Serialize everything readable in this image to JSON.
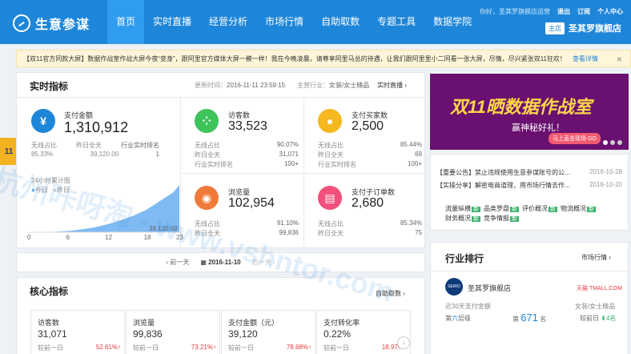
{
  "app": {
    "name": "生意参谋"
  },
  "nav": [
    "首页",
    "实时直播",
    "经营分析",
    "市场行情",
    "自助取数",
    "专题工具",
    "数据学院"
  ],
  "top_right": {
    "welcome": "你好，圣其罗旗舰店运营",
    "logout": "退出",
    "subscribe": "订阅",
    "personal": "个人中心"
  },
  "store": {
    "tag": "主店",
    "name": "圣其罗旗舰店"
  },
  "notice": {
    "text": "【双11官方同款大屏】数据作战室作战大屏今夜“变身”，跟阿里官方媒体大屏一模一样！我在今晚凌晨，请尊享阿里马总的待遇，让我们跟阿里里小二同看一张大屏，尽情，尽兴紧张双11狂欢！",
    "link": "查看详情",
    "close": "×"
  },
  "realtime": {
    "title": "实时指标",
    "updated_label": "更新时间：",
    "updated": "2016-11-11 23:59:15",
    "industry_label": "主营行业：",
    "industry": "女装/女士精品",
    "live_link": "实时直播",
    "metrics": [
      {
        "label": "支付金额",
        "value": "1,310,912",
        "icon": "yen-icon",
        "rows": [
          [
            "无线占比",
            ""
          ],
          [
            "85.33%",
            ""
          ]
        ],
        "sub1_label": "无线占比",
        "sub1": "85.33%",
        "sub2_label": "昨日全天",
        "sub2": "39,120.00",
        "sub3_label": "行业实时排名",
        "sub3": "1"
      },
      {
        "label": "访客数",
        "value": "33,523",
        "icon": "footprint-icon",
        "sub1_label": "无线占比",
        "sub1": "90.07%",
        "sub2_label": "昨日全天",
        "sub2": "31,071",
        "sub3_label": "行业实时排名",
        "sub3": "100+"
      },
      {
        "label": "支付买家数",
        "value": "2,500",
        "icon": "user-icon",
        "sub1_label": "无线占比",
        "sub1": "85.44%",
        "sub2_label": "昨日全天",
        "sub2": "69",
        "sub3_label": "行业实时排名",
        "sub3": "100+"
      },
      {
        "label": "浏览量",
        "value": "102,954",
        "icon": "eye-icon",
        "sub1_label": "无线占比",
        "sub1": "91.10%",
        "sub2_label": "昨日全天",
        "sub2": "99,836"
      },
      {
        "label": "支付子订单数",
        "value": "2,680",
        "icon": "order-icon",
        "sub1_label": "无线占比",
        "sub1": "85.34%",
        "sub2_label": "昨日全天",
        "sub2": "75"
      }
    ],
    "chart": {
      "title": "24小时累计图",
      "legend_today": "今日",
      "legend_yesterday": "昨日",
      "ticks": [
        "0",
        "6",
        "12",
        "18",
        "23"
      ],
      "end_value": "39,120.00"
    }
  },
  "chart_data": {
    "type": "area",
    "title": "24小时累计图",
    "x": [
      0,
      2,
      4,
      6,
      8,
      10,
      12,
      14,
      16,
      18,
      20,
      22,
      23
    ],
    "series": [
      {
        "name": "今日",
        "values": [
          0,
          200,
          500,
          1200,
          2500,
          4200,
          6800,
          10000,
          14000,
          19000,
          26000,
          33000,
          39120
        ]
      }
    ],
    "xlabel": "",
    "ylabel": "",
    "colors": {
      "today": "#6aaef0",
      "yesterday": "#c9c9c9"
    }
  },
  "date_nav": {
    "prev": "前一天",
    "date": "2016-11-10",
    "next": "后一天"
  },
  "core": {
    "title": "核心指标",
    "link": "自助取数",
    "cards": [
      {
        "label": "访客数",
        "value": "31,071",
        "cmp_label": "较前一日",
        "pct": "52.61%"
      },
      {
        "label": "浏览量",
        "value": "99,836",
        "cmp_label": "较前一日",
        "pct": "73.21%"
      },
      {
        "label": "支付金额（元）",
        "value": "39,120",
        "cmp_label": "较前一日",
        "pct": "78.68%"
      },
      {
        "label": "支付转化率",
        "value": "0.22%",
        "cmp_label": "较前一日",
        "pct": "18.97%"
      }
    ]
  },
  "banner": {
    "title": "双11晒数据作战室",
    "sub": "赢神秘好礼！",
    "button": "马上直击现场 GO"
  },
  "news": [
    {
      "text": "【重要公告】禁止违规使用生意参谋账号的公...",
      "date": "2016-10-28"
    },
    {
      "text": "【实操分享】解密电商道理，用市场行情去作...",
      "date": "2016-10-20"
    }
  ],
  "tags": [
    [
      "流量纵横",
      "新"
    ],
    [
      "品类罗盘",
      "新"
    ],
    [
      "评价概况",
      "新"
    ],
    [
      "物流概况",
      "新"
    ],
    [
      "财务概况",
      "新"
    ],
    [
      "竞争情报",
      "新"
    ]
  ],
  "rank": {
    "title": "行业排行",
    "link": "市场行情",
    "store_name": "圣其罗旗舰店",
    "platform": "天猫 TMALL.COM",
    "period": "近30天支付金额",
    "industry": "女装/女士精品",
    "level_label": "第",
    "level": "六",
    "level_suffix": "层级",
    "rank_label": "第",
    "rank": "671",
    "rank_suffix": "名",
    "change_label": "较前日",
    "change": "4名"
  },
  "watermark": "杭州咔呀淘 - www.vshntor.com"
}
